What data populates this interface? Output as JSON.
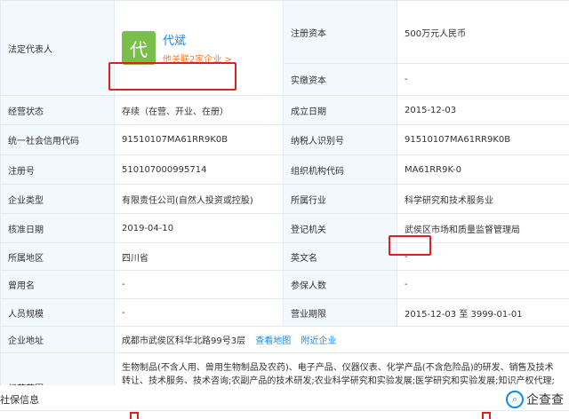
{
  "legal_rep": {
    "label": "法定代表人",
    "avatar_char": "代",
    "name": "代斌",
    "related_link": "他关联2家企业 >"
  },
  "rows": {
    "reg_capital": {
      "label": "注册资本",
      "value": "500万元人民币"
    },
    "paid_capital": {
      "label": "实缴资本",
      "value": "-"
    },
    "status": {
      "label": "经营状态",
      "value": "存续（在营、开业、在册）"
    },
    "founded": {
      "label": "成立日期",
      "value": "2015-12-03"
    },
    "credit_code": {
      "label": "统一社会信用代码",
      "value": "91510107MA61RR9K0B"
    },
    "taxpayer_id": {
      "label": "纳税人识别号",
      "value": "91510107MA61RR9K0B"
    },
    "reg_no": {
      "label": "注册号",
      "value": "510107000995714"
    },
    "org_code": {
      "label": "组织机构代码",
      "value": "MA61RR9K-0"
    },
    "company_type": {
      "label": "企业类型",
      "value": "有限责任公司(自然人投资或控股)"
    },
    "industry": {
      "label": "所属行业",
      "value": "科学研究和技术服务业"
    },
    "approval_date": {
      "label": "核准日期",
      "value": "2019-04-10"
    },
    "authority": {
      "label": "登记机关",
      "value": "武侯区市场和质量监督管理局"
    },
    "region": {
      "label": "所属地区",
      "value": "四川省"
    },
    "english_name": {
      "label": "英文名",
      "value": "-"
    },
    "former_name": {
      "label": "曾用名",
      "value": "-"
    },
    "insured": {
      "label": "参保人数",
      "value": "-"
    },
    "staff_size": {
      "label": "人员规模",
      "value": "-"
    },
    "business_term": {
      "label": "营业期限",
      "value": "2015-12-03 至 3999-01-01"
    },
    "address": {
      "label": "企业地址",
      "value": "成都市武侯区科华北路99号3层",
      "map_link": "查看地图",
      "nearby_link": "附近企业"
    },
    "scope": {
      "label": "经营范围",
      "value": "生物制品(不含人用、兽用生物制品及农药)、电子产品、仪器仪表、化学产品(不含危险品)的研发、销售及技术转让、技术服务、技术咨询;农副产品的技术研发;农业科学研究和实验发展;医学研究和实验发展;知识产权代理;会务服务;网络工程设计施工;销售:计算机耗材、实验室仪器、化学试剂(不含危险品)、机械设备、办公用品、医疗器械一二类。(依法须经批准的项目,经相关部门批准后方可开展经营活动)。"
    }
  },
  "footer": {
    "section_title": "社保信息",
    "brand_icon": "search-logo-icon",
    "brand_name": "企查查"
  },
  "colors": {
    "label_bg": "#f2f9fc",
    "link": "#128bed",
    "orange": "#fd7e22",
    "highlight": "#e02020",
    "avatar": "#7bbf4b"
  }
}
